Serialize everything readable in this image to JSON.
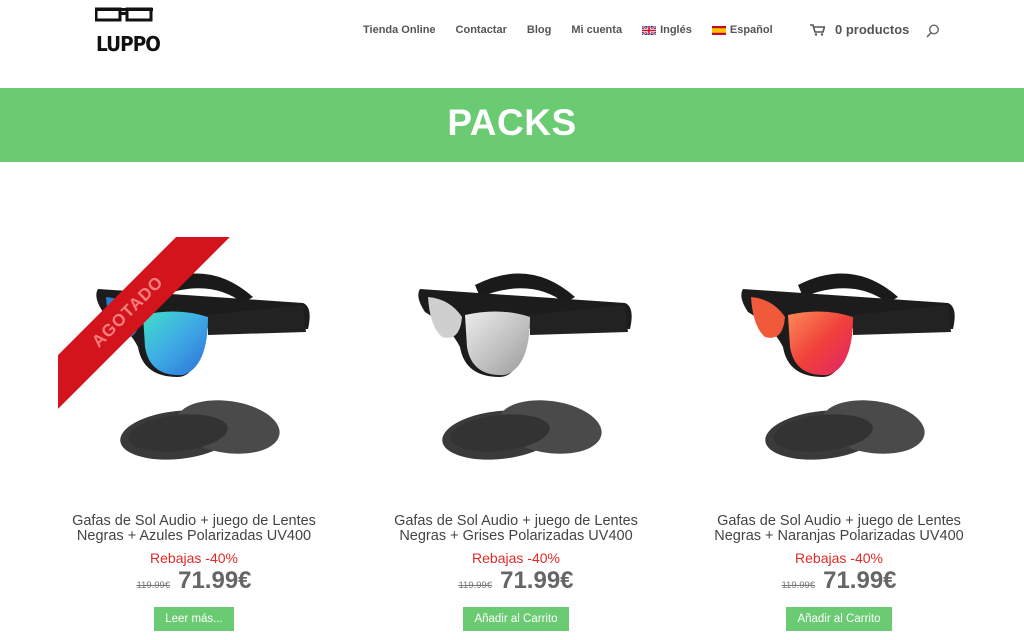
{
  "header": {
    "logo_text": "LUPPO",
    "nav": [
      {
        "label": "Tienda Online"
      },
      {
        "label": "Contactar"
      },
      {
        "label": "Blog"
      },
      {
        "label": "Mi cuenta"
      },
      {
        "label": "Inglés",
        "flag": "uk-flag-icon"
      },
      {
        "label": "Español",
        "flag": "spain-flag-icon"
      }
    ],
    "cart_label": "0 productos",
    "search_icon": "search-icon"
  },
  "banner": {
    "title": "PACKS"
  },
  "colors": {
    "accent": "#6acb73",
    "sale": "#e02b27",
    "ribbon": "#d4141c"
  },
  "products": [
    {
      "name": "Gafas de Sol Audio + juego de Lentes Negras + Azules Polarizadas UV400",
      "sale_label": "Rebajas -40%",
      "old_price": "119.99€",
      "new_price": "71.99€",
      "button": "Leer más...",
      "ribbon": "AGOTADO",
      "lens_color": "#3fa9e6"
    },
    {
      "name": "Gafas de Sol Audio + juego de Lentes Negras + Grises Polarizadas UV400",
      "sale_label": "Rebajas -40%",
      "old_price": "119.99€",
      "new_price": "71.99€",
      "button": "Añadir al Carrito",
      "lens_color": "#c9c9c9"
    },
    {
      "name": "Gafas de Sol Audio + juego de Lentes Negras + Naranjas Polarizadas UV400",
      "sale_label": "Rebajas -40%",
      "old_price": "119.99€",
      "new_price": "71.99€",
      "button": "Añadir al Carrito",
      "lens_color": "#f0413a"
    }
  ]
}
